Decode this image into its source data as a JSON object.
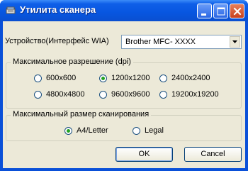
{
  "window": {
    "title": "Утилита сканера"
  },
  "device": {
    "label": "Устройство(Интерфейс WIA)",
    "value": "Brother MFC- XXXX"
  },
  "resolution": {
    "title": "Максимальное разрешение (dpi)",
    "options": [
      "600x600",
      "1200x1200",
      "2400x2400",
      "4800x4800",
      "9600x9600",
      "19200x19200"
    ],
    "selected": "1200x1200"
  },
  "scan_size": {
    "title": "Максимальный размер сканирования",
    "options": [
      "A4/Letter",
      "Legal"
    ],
    "selected": "A4/Letter"
  },
  "buttons": {
    "ok": "OK",
    "cancel": "Cancel"
  },
  "colors": {
    "titlebar": "#0756e0",
    "dialog_bg": "#ece9d8",
    "radio_selected": "#21a121",
    "close_button": "#c8401c"
  },
  "icons": {
    "app": "scanner-icon",
    "minimize": "minimize-icon",
    "maximize": "maximize-icon",
    "close": "close-icon",
    "dropdown": "chevron-down-icon"
  }
}
